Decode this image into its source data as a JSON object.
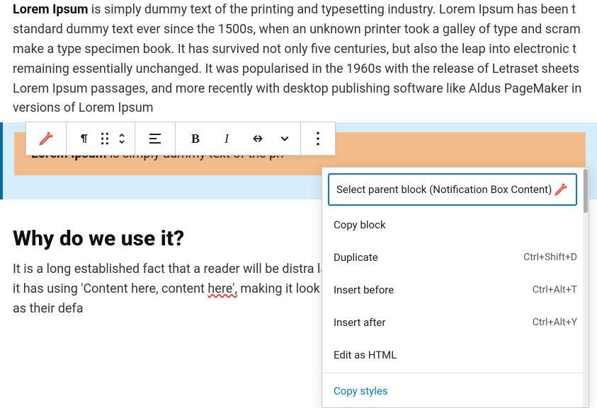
{
  "paragraph_intro_strong": "Lorem Ipsum",
  "paragraph_intro_rest": " is simply dummy text of the printing and typesetting industry. Lorem Ipsum has been t standard dummy text ever since the 1500s, when an unknown printer took a galley of type and scram make a type specimen book. It has survived not only five centuries, but also the leap into electronic t remaining essentially unchanged. It was popularised in the 1960s with the release of Letraset sheets Lorem Ipsum passages, and more recently with desktop publishing software like Aldus PageMaker in versions of Lorem Ipsum",
  "notification_strong": "Lorem Ipsum",
  "notification_rest": " is simply dummy text of the pri",
  "heading": "Why do we use it?",
  "paragraph2_a": "It is a long established fact that a reader will be distra layout. The point of using Lorem Ipsum is that it has using 'Content here, content ",
  "paragraph2_spell": "here',",
  "paragraph2_b": " making it look like web page editors now use Lorem Ipsum as their defa",
  "toolbar": {
    "bold": "B",
    "italic": "I"
  },
  "menu": {
    "parent": "Select parent block (Notification Box Content)",
    "copy": "Copy block",
    "duplicate": "Duplicate",
    "duplicate_kb": "Ctrl+Shift+D",
    "insert_before": "Insert before",
    "insert_before_kb": "Ctrl+Alt+T",
    "insert_after": "Insert after",
    "insert_after_kb": "Ctrl+Alt+Y",
    "edit_html": "Edit as HTML",
    "copy_styles": "Copy styles"
  }
}
